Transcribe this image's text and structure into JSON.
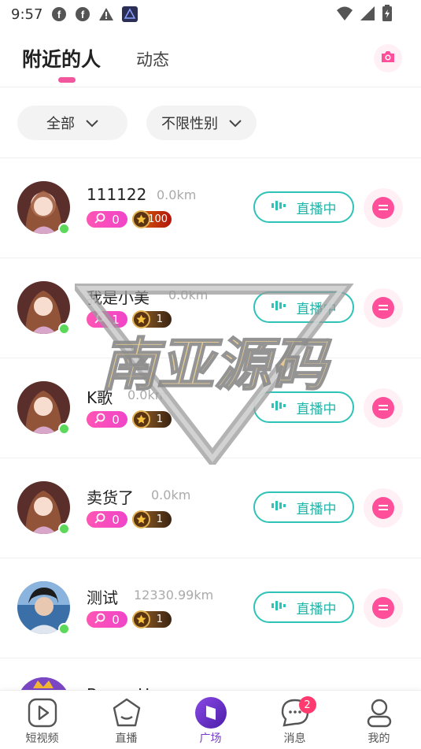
{
  "status_bar": {
    "time": "9:57",
    "left_icons": [
      "facebook-icon",
      "facebook-icon",
      "warning-icon",
      "app-icon"
    ],
    "right_icons": [
      "wifi-icon",
      "signal-icon",
      "battery-icon"
    ]
  },
  "header": {
    "tabs": [
      {
        "label": "附近的人",
        "active": true
      },
      {
        "label": "动态",
        "active": false
      }
    ],
    "camera_icon": "camera-icon"
  },
  "filters": {
    "all_label": "全部",
    "gender_label": "不限性别"
  },
  "users": [
    {
      "name": "111122",
      "distance": "0.0km",
      "likes": "0",
      "level": "100",
      "live_label": "直播中"
    },
    {
      "name": "我是小美",
      "distance": "0.0km",
      "likes": "1",
      "level": "1",
      "live_label": "直播中"
    },
    {
      "name": "K歌",
      "distance": "0.0km",
      "likes": "0",
      "level": "1",
      "live_label": "直播中"
    },
    {
      "name": "卖货了",
      "distance": "0.0km",
      "likes": "0",
      "level": "1",
      "live_label": "直播中"
    },
    {
      "name": "测试",
      "distance": "12330.99km",
      "likes": "0",
      "level": "1",
      "live_label": "直播中"
    }
  ],
  "partial_user": {
    "name": "Bryan Hayu"
  },
  "watermark": {
    "text": "南亚源码"
  },
  "tab_bar": {
    "items": [
      {
        "label": "短视频",
        "icon": "video-play-icon",
        "active": false
      },
      {
        "label": "直播",
        "icon": "live-face-icon",
        "active": false
      },
      {
        "label": "广场",
        "icon": "square-compass-icon",
        "active": true
      },
      {
        "label": "消息",
        "icon": "message-bubble-icon",
        "active": false,
        "badge": "2"
      },
      {
        "label": "我的",
        "icon": "profile-icon",
        "active": false
      }
    ]
  },
  "colors": {
    "accent_pink": "#f2569c",
    "live_teal": "#2fc3b8",
    "online_green": "#5cd85a",
    "active_tab_purple": "#7a3ad0"
  }
}
